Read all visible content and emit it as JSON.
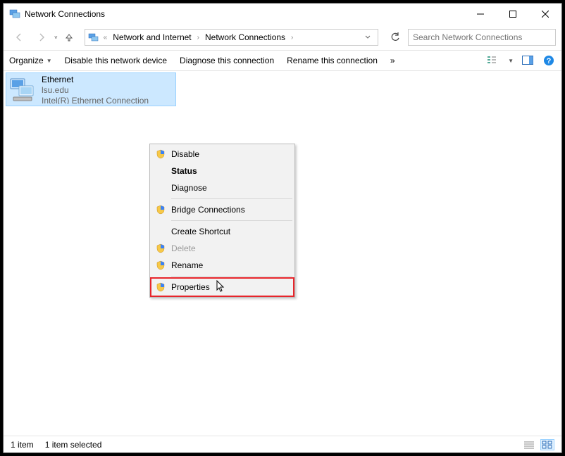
{
  "window": {
    "title": "Network Connections"
  },
  "breadcrumbs": {
    "item0": "Network and Internet",
    "item1": "Network Connections"
  },
  "search": {
    "placeholder": "Search Network Connections"
  },
  "toolbar": {
    "organize": "Organize",
    "disable": "Disable this network device",
    "diagnose": "Diagnose this connection",
    "rename": "Rename this connection",
    "more": "»"
  },
  "adapter": {
    "name": "Ethernet",
    "domain": "lsu.edu",
    "device": "Intel(R) Ethernet Connection"
  },
  "context_menu": {
    "disable": "Disable",
    "status": "Status",
    "diagnose": "Diagnose",
    "bridge": "Bridge Connections",
    "shortcut": "Create Shortcut",
    "delete": "Delete",
    "rename": "Rename",
    "properties": "Properties"
  },
  "statusbar": {
    "count": "1 item",
    "selected": "1 item selected"
  }
}
